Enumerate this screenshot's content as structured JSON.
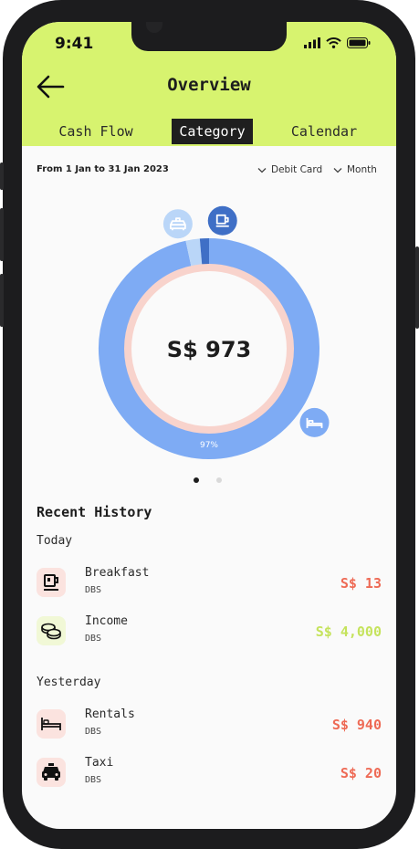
{
  "status_bar": {
    "time": "9:41"
  },
  "header": {
    "title": "Overview",
    "back_icon": "arrow-left-icon"
  },
  "tabs": [
    {
      "label": "Cash Flow",
      "active": false
    },
    {
      "label": "Category",
      "active": true
    },
    {
      "label": "Calendar",
      "active": false
    }
  ],
  "filters": {
    "date_range": "From 1 Jan to 31 Jan 2023",
    "account": "Debit Card",
    "period": "Month"
  },
  "summary": {
    "total": "S$ 973",
    "main_segment_label": "97%"
  },
  "chart_data": {
    "type": "pie",
    "categories": [
      "Rentals",
      "Taxi",
      "Breakfast"
    ],
    "values": [
      940,
      20,
      13
    ],
    "data_labels": [
      "97%",
      "",
      ""
    ],
    "colors": [
      "#7eabf4",
      "#bad6f8",
      "#3f6fc6"
    ],
    "icons": [
      "bed-icon",
      "taxi-icon",
      "coffee-icon"
    ]
  },
  "pagination": {
    "pages": 2,
    "current": 1
  },
  "recent": {
    "title": "Recent History",
    "groups": [
      {
        "label": "Today",
        "items": [
          {
            "name": "Breakfast",
            "bank": "DBS",
            "amount": "S$ 13",
            "icon": "coffee-icon",
            "type": "expense"
          },
          {
            "name": "Income",
            "bank": "DBS",
            "amount": "S$ 4,000",
            "icon": "coins-icon",
            "type": "income"
          }
        ]
      },
      {
        "label": "Yesterday",
        "items": [
          {
            "name": "Rentals",
            "bank": "DBS",
            "amount": "S$ 940",
            "icon": "bed-icon",
            "type": "expense"
          },
          {
            "name": "Taxi",
            "bank": "DBS",
            "amount": "S$ 20",
            "icon": "taxi-icon",
            "type": "expense"
          }
        ]
      }
    ]
  },
  "colors": {
    "accent": "#d7f36f",
    "expense": "#ee6a55",
    "income": "#c5e35c",
    "ring_inner": "#f8d3cc",
    "ring_main": "#7eabf4"
  }
}
